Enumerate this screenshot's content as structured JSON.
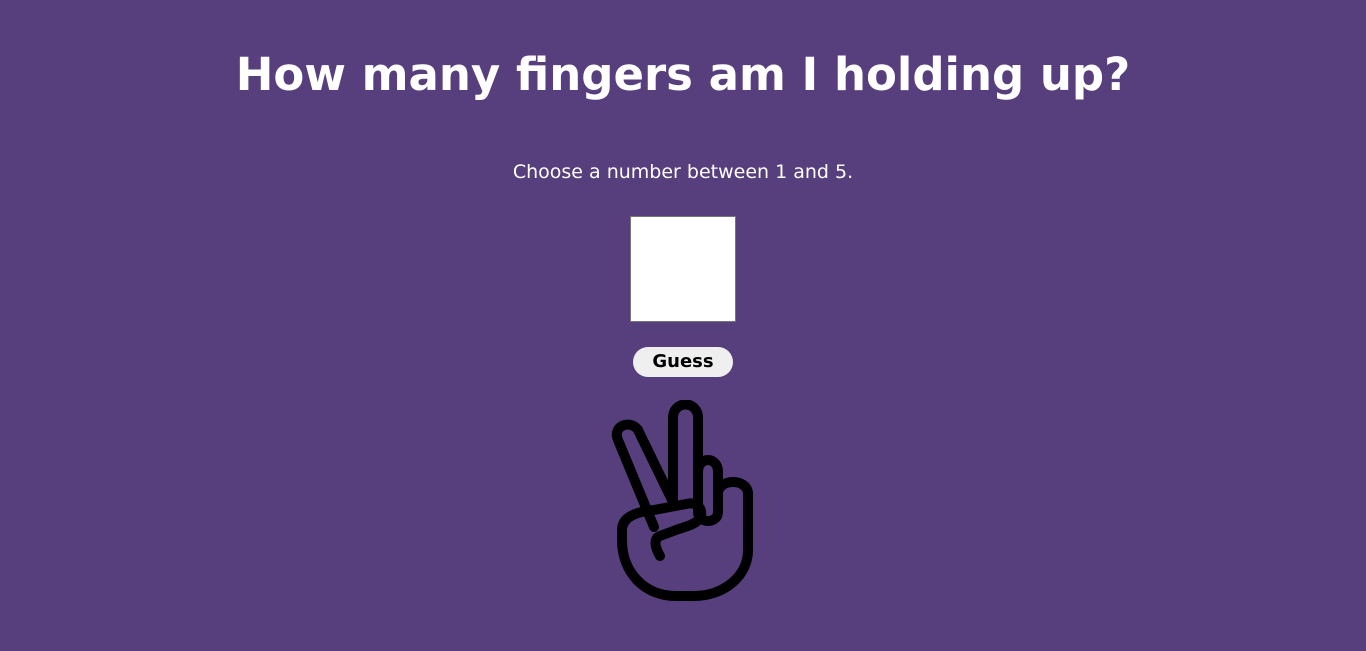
{
  "page": {
    "title": "How many fingers am I holding up?",
    "instructions": "Choose a number between 1 and 5.",
    "background_color": "#573e7d"
  },
  "form": {
    "guess_input": {
      "value": "",
      "placeholder": ""
    },
    "guess_button_label": "Guess"
  },
  "image": {
    "icon": "peace-hand-icon",
    "fingers_shown": 2
  }
}
